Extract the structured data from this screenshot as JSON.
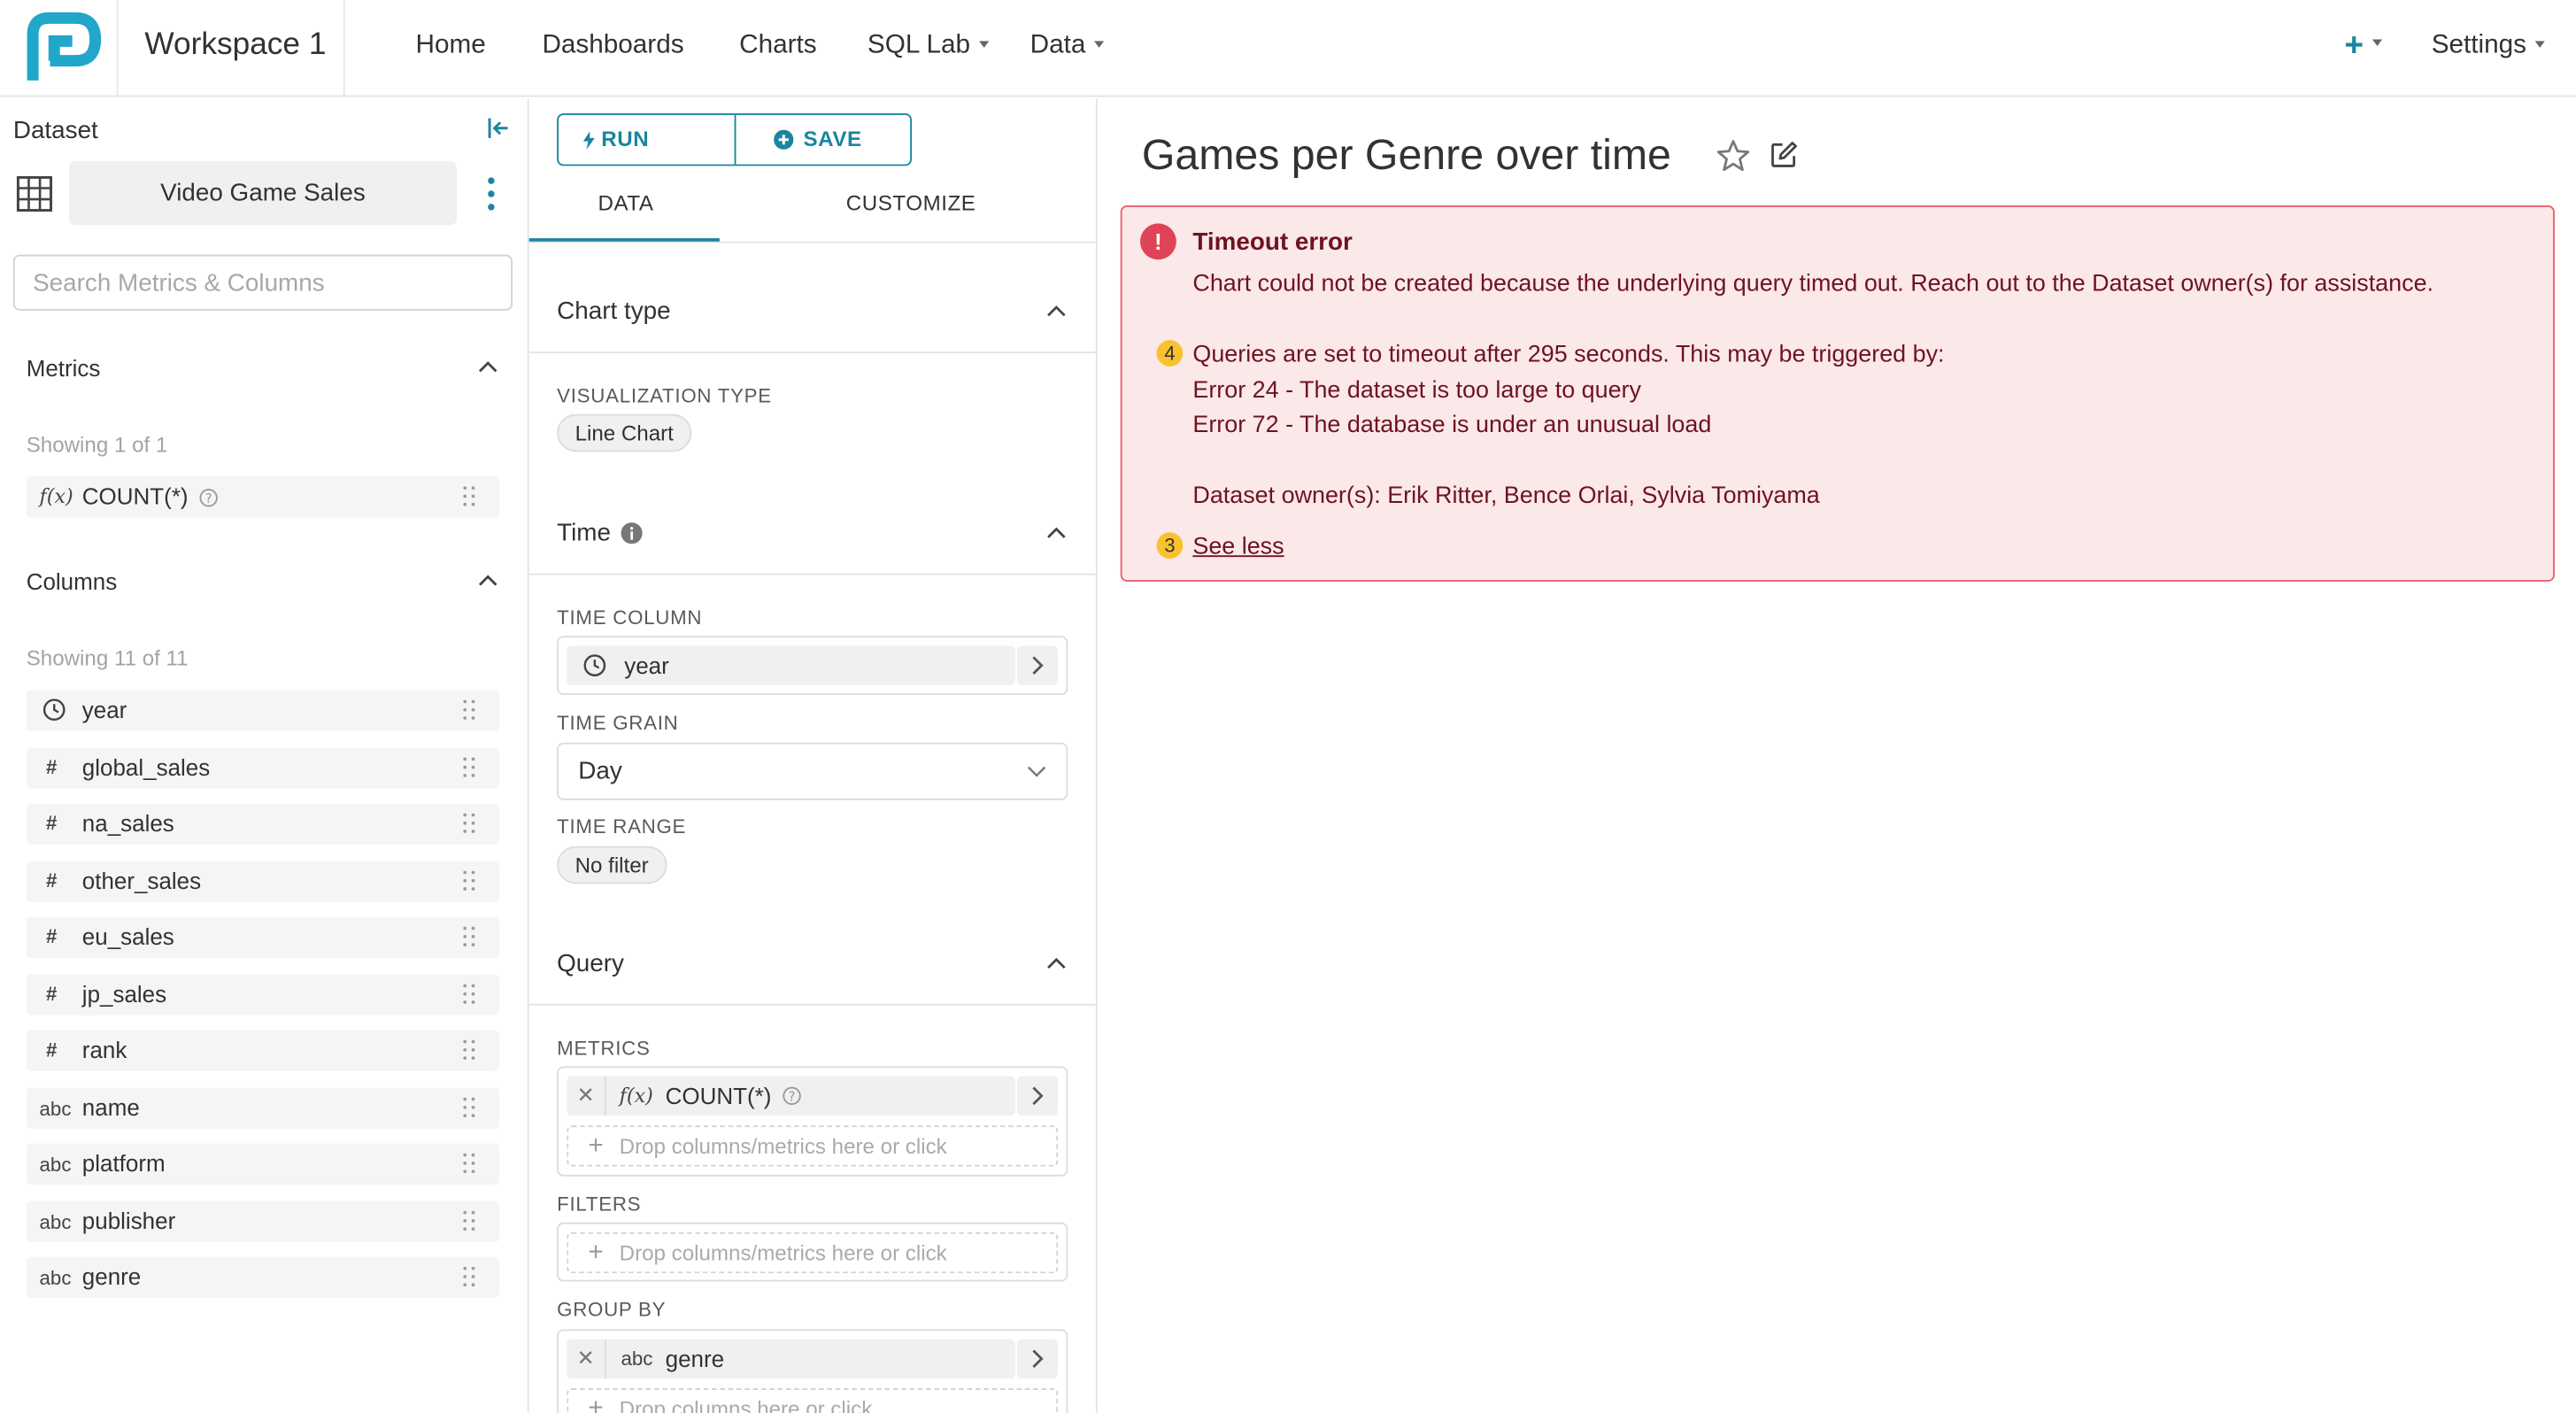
{
  "header": {
    "workspace": "Workspace 1",
    "nav": [
      {
        "label": "Home"
      },
      {
        "label": "Dashboards"
      },
      {
        "label": "Charts"
      },
      {
        "label": "SQL Lab"
      },
      {
        "label": "Data"
      }
    ],
    "settings": "Settings",
    "brand_color": "#1a85a0",
    "logo_color": "#20a7c9",
    "add_icon": "plus-icon"
  },
  "dataset_panel": {
    "label": "Dataset",
    "dataset_name": "Video Game Sales",
    "search_placeholder": "Search Metrics & Columns",
    "metrics_title": "Metrics",
    "metrics_showing": "Showing 1 of 1",
    "metrics": [
      {
        "type_icon": "f(x)",
        "name": "COUNT(*)"
      }
    ],
    "columns_title": "Columns",
    "columns_showing": "Showing 11 of 11",
    "columns": [
      {
        "type_icon": "clock",
        "name": "year"
      },
      {
        "type_icon": "#",
        "name": "global_sales"
      },
      {
        "type_icon": "#",
        "name": "na_sales"
      },
      {
        "type_icon": "#",
        "name": "other_sales"
      },
      {
        "type_icon": "#",
        "name": "eu_sales"
      },
      {
        "type_icon": "#",
        "name": "jp_sales"
      },
      {
        "type_icon": "#",
        "name": "rank"
      },
      {
        "type_icon": "abc",
        "name": "name"
      },
      {
        "type_icon": "abc",
        "name": "platform"
      },
      {
        "type_icon": "abc",
        "name": "publisher"
      },
      {
        "type_icon": "abc",
        "name": "genre"
      }
    ]
  },
  "control_panel": {
    "run_label": "RUN",
    "save_label": "SAVE",
    "tab_data": "DATA",
    "tab_customize": "CUSTOMIZE",
    "chart_type_title": "Chart type",
    "viz_type_caption": "VISUALIZATION TYPE",
    "viz_type_value": "Line Chart",
    "time_title": "Time",
    "time_column_caption": "TIME COLUMN",
    "time_column_value": "year",
    "time_grain_caption": "TIME GRAIN",
    "time_grain_value": "Day",
    "time_range_caption": "TIME RANGE",
    "time_range_value": "No filter",
    "query_title": "Query",
    "metrics_caption": "METRICS",
    "metric_value": "COUNT(*)",
    "metric_icon": "f(x)",
    "metrics_drop": "Drop columns/metrics here or click",
    "filters_caption": "FILTERS",
    "filters_drop": "Drop columns/metrics here or click",
    "groupby_caption": "GROUP BY",
    "groupby_icon": "abc",
    "groupby_value": "genre",
    "groupby_drop": "Drop columns here or click"
  },
  "chart": {
    "title": "Games per Genre over time",
    "error": {
      "title": "Timeout error",
      "message": "Chart could not be created because the underlying query timed out. Reach out to the Dataset owner(s) for assistance.",
      "badge1": "4",
      "detail_line1": "Queries are set to timeout after 295 seconds. This may be triggered by:",
      "detail_line2": "Error 24 - The dataset is too large to query",
      "detail_line3": "Error 72 - The database is under an unusual load",
      "owners": "Dataset owner(s): Erik Ritter, Bence Orlai, Sylvia Tomiyama",
      "badge2": "3",
      "see_less": "See less",
      "bg_color": "#fbe8e9",
      "border_color": "#e8606a"
    }
  }
}
